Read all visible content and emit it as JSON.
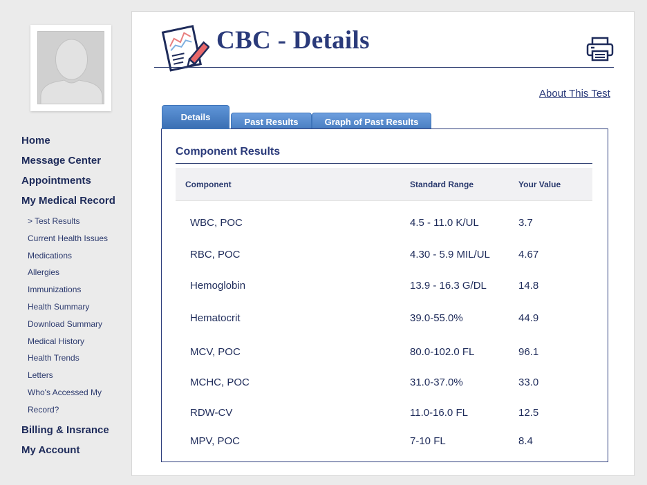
{
  "sidebar": {
    "nav_main": [
      "Home",
      "Message Center",
      "Appointments",
      "My Medical Record"
    ],
    "nav_sub": [
      "> Test Results",
      "Current Health Issues",
      "Medications",
      "Allergies",
      "Immunizations",
      "Health Summary",
      "Download Summary",
      "Medical History",
      "Health Trends",
      "Letters"
    ],
    "nav_sub_wrapped": {
      "line1": "Who's Accessed My",
      "line2": "Record?"
    },
    "nav_main_after": [
      "Billing & Insrance",
      "My Account"
    ]
  },
  "header": {
    "title": "CBC - Details",
    "about_link": "About This Test"
  },
  "tabs": [
    {
      "label": "Details",
      "active": true
    },
    {
      "label": "Past Results",
      "active": false
    },
    {
      "label": "Graph of Past Results",
      "active": false
    }
  ],
  "results": {
    "section_title": "Component Results",
    "columns": [
      "Component",
      "Standard Range",
      "Your Value"
    ],
    "rows": [
      {
        "component": "WBC, POC",
        "range": "4.5 - 11.0 K/UL",
        "value": "3.7"
      },
      {
        "component": "RBC, POC",
        "range": "4.30 - 5.9 MIL/UL",
        "value": "4.67"
      },
      {
        "component": "Hemoglobin",
        "range": "13.9 - 16.3 G/DL",
        "value": "14.8"
      },
      {
        "component": "Hematocrit",
        "range": "39.0-55.0%",
        "value": "44.9"
      },
      {
        "component": "MCV, POC",
        "range": "80.0-102.0 FL",
        "value": "96.1"
      },
      {
        "component": "MCHC, POC",
        "range": "31.0-37.0%",
        "value": "33.0"
      },
      {
        "component": "RDW-CV",
        "range": "11.0-16.0 FL",
        "value": "12.5"
      },
      {
        "component": "MPV, POC",
        "range": "7-10 FL",
        "value": "8.4"
      }
    ]
  },
  "icons": {
    "avatar": "avatar-placeholder",
    "header": "report-chart-pencil-icon",
    "print": "printer-icon"
  },
  "colors": {
    "navy": "#1e2b5a",
    "title": "#2a3a7a",
    "tab_blue": "#4a7fc2",
    "background": "#ebebeb"
  }
}
